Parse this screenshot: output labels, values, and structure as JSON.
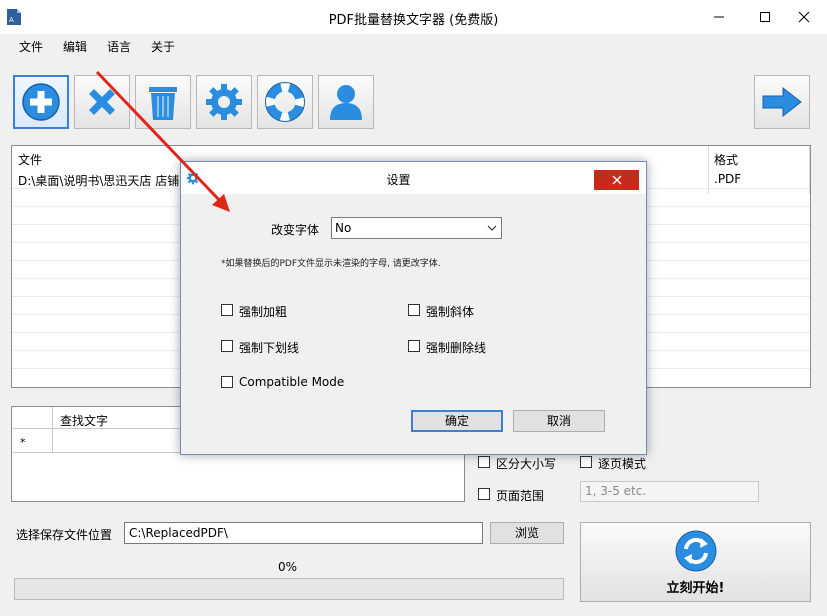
{
  "window": {
    "title": "PDF批量替换文字器 (免费版)"
  },
  "menu": {
    "items": [
      "文件",
      "编辑",
      "语言",
      "关于"
    ]
  },
  "file_list": {
    "columns": [
      "文件",
      "格式"
    ],
    "rows": [
      {
        "file": "D:\\桌面\\说明书\\思迅天店 店铺",
        "format": ".PDF"
      }
    ]
  },
  "find_table": {
    "column": "查找文字",
    "new_row_marker": "*"
  },
  "options": {
    "case_label": "区分大小写",
    "page_mode_label": "逐页模式",
    "page_range_label": "页面范围",
    "page_range_placeholder": "1, 3-5 etc."
  },
  "save": {
    "label": "选择保存文件位置",
    "path": "C:\\ReplacedPDF\\",
    "browse_label": "浏览"
  },
  "progress": {
    "percent_text": "0%",
    "value": 0
  },
  "start_button": {
    "label": "立刻开始!"
  },
  "dialog": {
    "title": "设置",
    "font_label": "改变字体",
    "font_value": "No",
    "note": "*如果替换后的PDF文件显示未渲染的字母, 请更改字体.",
    "bold_label": "强制加粗",
    "italic_label": "强制斜体",
    "underline_label": "强制下划线",
    "strike_label": "强制删除线",
    "compat_label": "Compatible Mode",
    "ok_label": "确定",
    "cancel_label": "取消"
  },
  "colors": {
    "accent": "#2b7fd6",
    "close": "#c42b1c",
    "arrow": "#e0251b"
  }
}
